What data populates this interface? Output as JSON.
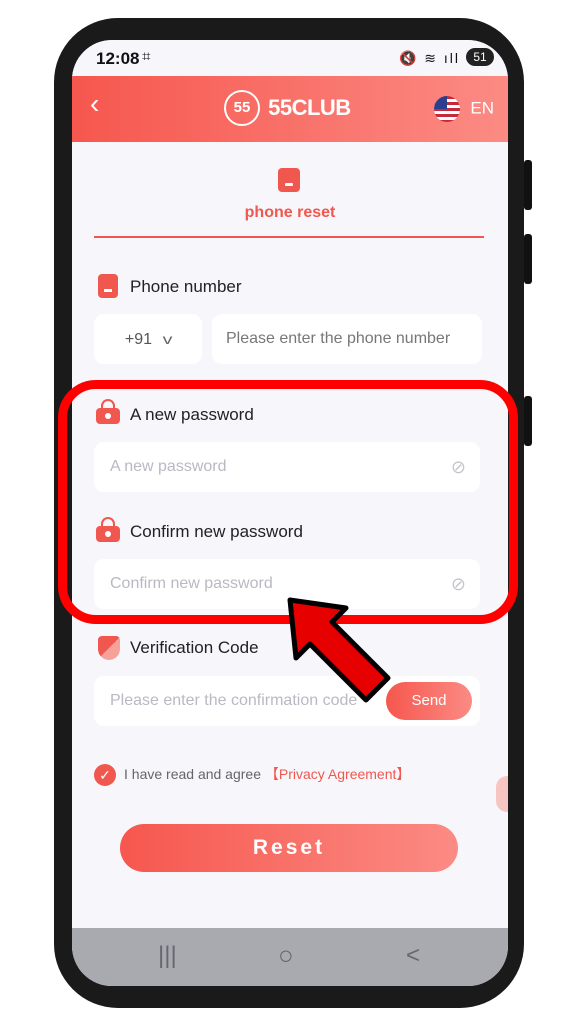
{
  "status": {
    "time": "12:08",
    "battery": "51"
  },
  "header": {
    "logo_badge": "55",
    "logo_text": "55CLUB",
    "lang": "EN"
  },
  "tab": {
    "label": "phone reset"
  },
  "phone": {
    "label": "Phone number",
    "country_code": "+91",
    "placeholder": "Please enter the phone number"
  },
  "new_password": {
    "label": "A new password",
    "placeholder": "A new password"
  },
  "confirm_password": {
    "label": "Confirm new password",
    "placeholder": "Confirm new password"
  },
  "verification": {
    "label": "Verification Code",
    "placeholder": "Please enter the confirmation code",
    "send_label": "Send"
  },
  "agreement": {
    "text": "I have read and agree",
    "link": "【Privacy Agreement】"
  },
  "reset_label": "Reset",
  "navbar": {
    "recent": "|||",
    "home": "○",
    "back": "<"
  },
  "colors": {
    "accent": "#f0584f",
    "highlight": "#ff0000"
  },
  "icons": [
    "back-icon",
    "flag-us-icon",
    "phone-icon",
    "lock-icon",
    "shield-icon",
    "eye-off-icon",
    "checkmark-icon"
  ]
}
